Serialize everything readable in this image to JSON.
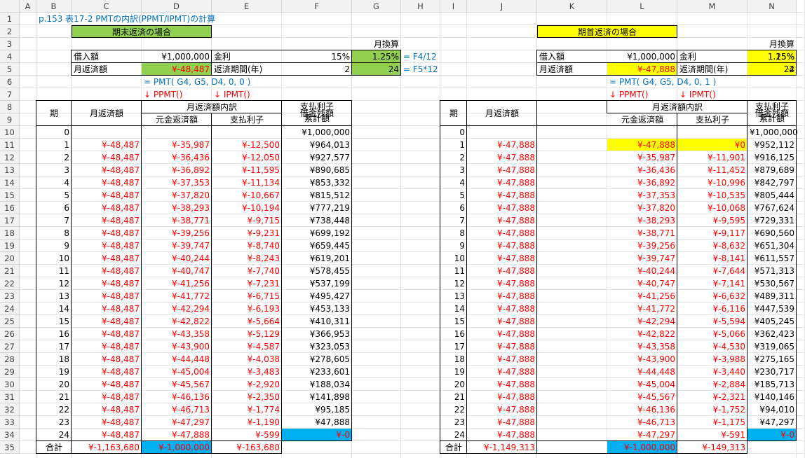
{
  "sheet": {
    "columns": [
      "A",
      "B",
      "C",
      "D",
      "E",
      "F",
      "G",
      "H",
      "I",
      "J",
      "K",
      "L",
      "M",
      "N"
    ],
    "rows": [
      "1",
      "2",
      "3",
      "4",
      "5",
      "6",
      "7",
      "8",
      "9",
      "10",
      "11",
      "12",
      "13",
      "14",
      "15",
      "16",
      "17",
      "18",
      "19",
      "20",
      "21",
      "22",
      "23",
      "24",
      "25",
      "26",
      "27",
      "28",
      "29",
      "30",
      "31",
      "32",
      "33",
      "34",
      "35"
    ]
  },
  "title": "p.153 表17-2 PMTの内訳(PPMT/IPMT)の計算",
  "colors": {
    "green": "#92d050",
    "yellow": "#ffff00",
    "cyan": "#00b0f0",
    "red": "#ff0000",
    "blue": "#0070c0"
  },
  "left": {
    "heading": "期末返済の場合",
    "monthly_label": "月換算",
    "loan_label": "借入額",
    "loan": "¥1,000,000",
    "rate_label": "金利",
    "rate": "15%",
    "rate_month": "1.25%",
    "rate_formula": "= F4/12",
    "pay_label": "月返済額",
    "pay": "¥-48,487",
    "term_label": "返済期間(年)",
    "term": "2",
    "term_month": "24",
    "term_formula": "= F5*12",
    "formula": "= PMT( G4, G5, D4, 0, 0 )",
    "ppmt": "↓ PPMT()",
    "ipmt": "↓ IPMT()",
    "h_period": "期",
    "h_payment": "月返済額",
    "h_breakdown": "月返済額内訳",
    "h_principal": "元金返済額",
    "h_interest": "支払利子",
    "h_balance": "借金残額",
    "h_cum1": "支払利子",
    "h_cum2": "累計額",
    "rows": [
      [
        "0",
        "",
        "",
        "",
        "¥1,000,000"
      ],
      [
        "1",
        "¥-48,487",
        "¥-35,987",
        "¥-12,500",
        "¥964,013"
      ],
      [
        "2",
        "¥-48,487",
        "¥-36,436",
        "¥-12,050",
        "¥927,577"
      ],
      [
        "3",
        "¥-48,487",
        "¥-36,892",
        "¥-11,595",
        "¥890,685"
      ],
      [
        "4",
        "¥-48,487",
        "¥-37,353",
        "¥-11,134",
        "¥853,332"
      ],
      [
        "5",
        "¥-48,487",
        "¥-37,820",
        "¥-10,667",
        "¥815,512"
      ],
      [
        "6",
        "¥-48,487",
        "¥-38,293",
        "¥-10,194",
        "¥777,219"
      ],
      [
        "7",
        "¥-48,487",
        "¥-38,771",
        "¥-9,715",
        "¥738,448"
      ],
      [
        "8",
        "¥-48,487",
        "¥-39,256",
        "¥-9,231",
        "¥699,192"
      ],
      [
        "9",
        "¥-48,487",
        "¥-39,747",
        "¥-8,740",
        "¥659,445"
      ],
      [
        "10",
        "¥-48,487",
        "¥-40,244",
        "¥-8,243",
        "¥619,201"
      ],
      [
        "11",
        "¥-48,487",
        "¥-40,747",
        "¥-7,740",
        "¥578,455"
      ],
      [
        "12",
        "¥-48,487",
        "¥-41,256",
        "¥-7,231",
        "¥537,199"
      ],
      [
        "13",
        "¥-48,487",
        "¥-41,772",
        "¥-6,715",
        "¥495,427"
      ],
      [
        "14",
        "¥-48,487",
        "¥-42,294",
        "¥-6,193",
        "¥453,133"
      ],
      [
        "15",
        "¥-48,487",
        "¥-42,822",
        "¥-5,664",
        "¥410,311"
      ],
      [
        "16",
        "¥-48,487",
        "¥-43,358",
        "¥-5,129",
        "¥366,953"
      ],
      [
        "17",
        "¥-48,487",
        "¥-43,900",
        "¥-4,587",
        "¥323,053"
      ],
      [
        "18",
        "¥-48,487",
        "¥-44,448",
        "¥-4,038",
        "¥278,605"
      ],
      [
        "19",
        "¥-48,487",
        "¥-45,004",
        "¥-3,483",
        "¥233,601"
      ],
      [
        "20",
        "¥-48,487",
        "¥-45,567",
        "¥-2,920",
        "¥188,034"
      ],
      [
        "21",
        "¥-48,487",
        "¥-46,136",
        "¥-2,350",
        "¥141,898"
      ],
      [
        "22",
        "¥-48,487",
        "¥-46,713",
        "¥-1,774",
        "¥95,185"
      ],
      [
        "23",
        "¥-48,487",
        "¥-47,297",
        "¥-1,190",
        "¥47,888"
      ],
      [
        "24",
        "¥-48,487",
        "¥-47,888",
        "¥-599",
        "¥-0"
      ]
    ],
    "total_label": "合計",
    "total_payment": "¥-1,163,680",
    "total_principal": "¥-1,000,000",
    "total_interest": "¥-163,680"
  },
  "right": {
    "heading": "期首返済の場合",
    "monthly_label": "月換算",
    "loan_label": "借入額",
    "loan": "¥1,000,000",
    "rate_label": "金利",
    "rate": "15%",
    "rate_month": "1.25%",
    "pay_label": "月返済額",
    "pay": "¥-47,888",
    "term_label": "返済期間(年)",
    "term": "2",
    "term_month": "24",
    "formula": "= PMT( G4, G5, D4, 0, 1 )",
    "ppmt": "↓ PPMT()",
    "ipmt": "↓ IPMT()",
    "h_period": "期",
    "h_payment": "月返済額",
    "h_breakdown": "月返済額内訳",
    "h_principal": "元金返済額",
    "h_interest": "支払利子",
    "h_balance": "借金残額",
    "h_cum1": "支払利子",
    "h_cum2": "累計額",
    "rows": [
      [
        "0",
        "",
        "",
        "",
        "¥1,000,000"
      ],
      [
        "1",
        "¥-47,888",
        "¥-47,888",
        "¥0",
        "¥952,112"
      ],
      [
        "2",
        "¥-47,888",
        "¥-35,987",
        "¥-11,901",
        "¥916,125"
      ],
      [
        "3",
        "¥-47,888",
        "¥-36,436",
        "¥-11,452",
        "¥879,689"
      ],
      [
        "4",
        "¥-47,888",
        "¥-36,892",
        "¥-10,996",
        "¥842,797"
      ],
      [
        "5",
        "¥-47,888",
        "¥-37,353",
        "¥-10,535",
        "¥805,444"
      ],
      [
        "6",
        "¥-47,888",
        "¥-37,820",
        "¥-10,068",
        "¥767,624"
      ],
      [
        "7",
        "¥-47,888",
        "¥-38,293",
        "¥-9,595",
        "¥729,331"
      ],
      [
        "8",
        "¥-47,888",
        "¥-38,771",
        "¥-9,117",
        "¥690,560"
      ],
      [
        "9",
        "¥-47,888",
        "¥-39,256",
        "¥-8,632",
        "¥651,304"
      ],
      [
        "10",
        "¥-47,888",
        "¥-39,747",
        "¥-8,141",
        "¥611,557"
      ],
      [
        "11",
        "¥-47,888",
        "¥-40,244",
        "¥-7,644",
        "¥571,313"
      ],
      [
        "12",
        "¥-47,888",
        "¥-40,747",
        "¥-7,141",
        "¥530,567"
      ],
      [
        "13",
        "¥-47,888",
        "¥-41,256",
        "¥-6,632",
        "¥489,311"
      ],
      [
        "14",
        "¥-47,888",
        "¥-41,772",
        "¥-6,116",
        "¥447,539"
      ],
      [
        "15",
        "¥-47,888",
        "¥-42,294",
        "¥-5,594",
        "¥405,245"
      ],
      [
        "16",
        "¥-47,888",
        "¥-42,822",
        "¥-5,066",
        "¥362,423"
      ],
      [
        "17",
        "¥-47,888",
        "¥-43,358",
        "¥-4,530",
        "¥319,065"
      ],
      [
        "18",
        "¥-47,888",
        "¥-43,900",
        "¥-3,988",
        "¥275,165"
      ],
      [
        "19",
        "¥-47,888",
        "¥-44,448",
        "¥-3,440",
        "¥230,717"
      ],
      [
        "20",
        "¥-47,888",
        "¥-45,004",
        "¥-2,884",
        "¥185,713"
      ],
      [
        "21",
        "¥-47,888",
        "¥-45,567",
        "¥-2,321",
        "¥140,146"
      ],
      [
        "22",
        "¥-47,888",
        "¥-46,136",
        "¥-1,752",
        "¥94,010"
      ],
      [
        "23",
        "¥-47,888",
        "¥-46,713",
        "¥-1,175",
        "¥47,297"
      ],
      [
        "24",
        "¥-47,888",
        "¥-47,297",
        "¥-591",
        "¥-0"
      ]
    ],
    "total_label": "合計",
    "total_payment": "¥-1,149,313",
    "total_principal": "¥-1,000,000",
    "total_interest": "¥-149,313"
  }
}
